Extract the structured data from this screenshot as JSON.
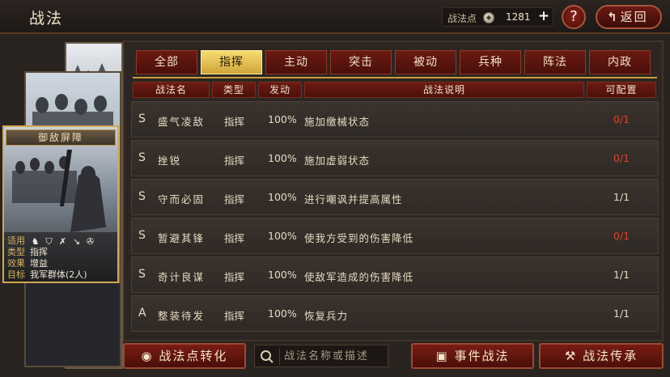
{
  "header": {
    "title": "战法",
    "points_label": "战法点",
    "points_value": "1281",
    "plus": "+",
    "help": "?",
    "back_label": "返回"
  },
  "card": {
    "title": "御敌屏障",
    "info": [
      {
        "key": "适用",
        "value": ""
      },
      {
        "key": "类型",
        "value": "指挥"
      },
      {
        "key": "效果",
        "value": "增益"
      },
      {
        "key": "目标",
        "value": "我军群体(2人)"
      }
    ],
    "troop_icons": [
      "cavalry-icon",
      "shield-icon",
      "bow-icon",
      "spear-icon",
      "wheel-icon"
    ]
  },
  "tabs": [
    "全部",
    "指挥",
    "主动",
    "突击",
    "被动",
    "兵种",
    "阵法",
    "内政"
  ],
  "active_tab": 1,
  "columns": [
    "战法名",
    "类型",
    "发动",
    "战法说明",
    "可配置"
  ],
  "rows": [
    {
      "grade": "S",
      "name": "盛气凌敌",
      "type": "指挥",
      "rate": "100%",
      "desc": "施加缴械状态",
      "conf": "0/1",
      "conf_red": true
    },
    {
      "grade": "S",
      "name": "挫锐",
      "type": "指挥",
      "rate": "100%",
      "desc": "施加虚弱状态",
      "conf": "0/1",
      "conf_red": true
    },
    {
      "grade": "S",
      "name": "守而必固",
      "type": "指挥",
      "rate": "100%",
      "desc": "进行嘲讽并提高属性",
      "conf": "1/1",
      "conf_red": false
    },
    {
      "grade": "S",
      "name": "暂避其锋",
      "type": "指挥",
      "rate": "100%",
      "desc": "使我方受到的伤害降低",
      "conf": "0/1",
      "conf_red": true
    },
    {
      "grade": "S",
      "name": "奇计良谋",
      "type": "指挥",
      "rate": "100%",
      "desc": "使敌军造成的伤害降低",
      "conf": "1/1",
      "conf_red": false
    },
    {
      "grade": "A",
      "name": "整装待发",
      "type": "指挥",
      "rate": "100%",
      "desc": "恢复兵力",
      "conf": "1/1",
      "conf_red": false
    }
  ],
  "bottom": {
    "convert_label": "战法点转化",
    "search_placeholder": "战法名称或描述",
    "event_label": "事件战法",
    "inherit_label": "战法传承"
  },
  "colors": {
    "accent_gold": "#cfa439",
    "button_red": "#6b1a12",
    "conf_red": "#d9442c"
  }
}
